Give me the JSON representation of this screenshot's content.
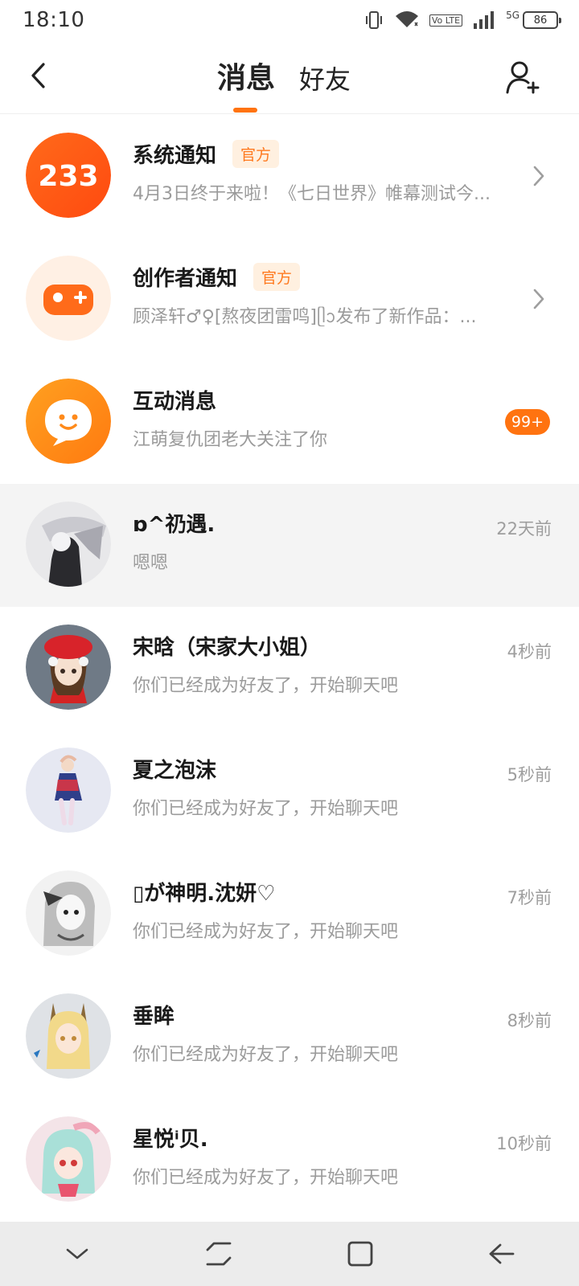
{
  "status_bar": {
    "time": "18:10",
    "network": "5G",
    "volte": "Vo LTE",
    "battery": "86"
  },
  "header": {
    "tabs": [
      {
        "label": "消息",
        "active": true
      },
      {
        "label": "好友",
        "active": false
      }
    ]
  },
  "colors": {
    "accent": "#ff7310",
    "official_badge_bg": "#fff0e0",
    "official_badge_text": "#ff7a20"
  },
  "system_rows": [
    {
      "title": "系统通知",
      "badge": "官方",
      "subtitle": "4月3日终于来啦！《七日世界》帷幕测试今...",
      "icon": "logo-233-icon"
    },
    {
      "title": "创作者通知",
      "badge": "官方",
      "subtitle": "顾泽轩♂♀[熬夜团雷鸣]ᥫᩣ发布了新作品：...",
      "icon": "gamepad-icon"
    },
    {
      "title": "互动消息",
      "subtitle": "江萌复仇团老大关注了你",
      "count": "99+",
      "icon": "smile-chat-icon"
    }
  ],
  "chats": [
    {
      "name": "ɒ^礽遇.",
      "message": "嗯嗯",
      "time": "22天前"
    },
    {
      "name": "宋晗（宋家大小姐）",
      "message": "你们已经成为好友了，开始聊天吧",
      "time": "4秒前"
    },
    {
      "name": "夏之泡沫",
      "message": "你们已经成为好友了，开始聊天吧",
      "time": "5秒前"
    },
    {
      "name": "▯が神明.沈妍♡",
      "message": "你们已经成为好友了，开始聊天吧",
      "time": "7秒前"
    },
    {
      "name": "垂眸",
      "message": "你们已经成为好友了，开始聊天吧",
      "time": "8秒前"
    },
    {
      "name": "星悦ⁱ贝.",
      "message": "你们已经成为好友了，开始聊天吧",
      "time": "10秒前"
    }
  ],
  "icons": {
    "back": "back-arrow-icon",
    "add_friend": "add-friend-icon",
    "nav": [
      "nav-down-icon",
      "recents-icon",
      "home-icon",
      "nav-back-icon"
    ]
  }
}
